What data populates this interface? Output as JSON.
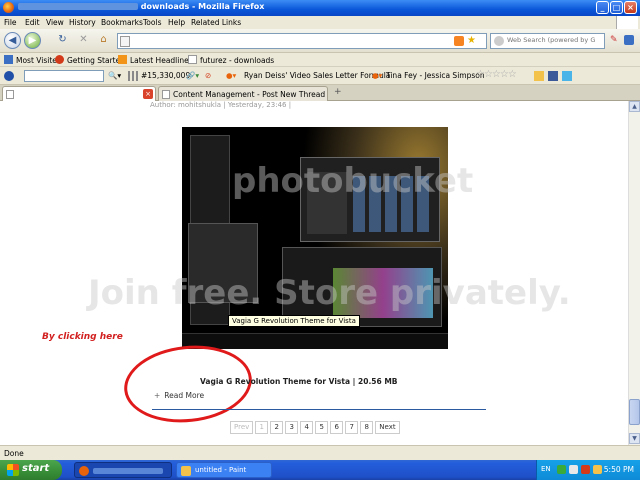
{
  "window": {
    "title_prefix": "",
    "title_suffix": "downloads - Mozilla Firefox"
  },
  "menu": [
    "File",
    "Edit",
    "View",
    "History",
    "Bookmarks",
    "Tools",
    "Help",
    "Related Links"
  ],
  "nav": {
    "url": "",
    "search_placeholder": "Web Search (powered by G"
  },
  "bookmarks": [
    {
      "label": "Most Visited",
      "color": "#3a6fc4"
    },
    {
      "label": "Getting Started",
      "color": "#d23a1a"
    },
    {
      "label": "Latest Headlines",
      "color": "#f29418"
    },
    {
      "label": "futurez - downloads",
      "color": "#3a6fc4"
    }
  ],
  "toolbar2": {
    "count": "#15,330,009",
    "link1": "Ryan Deiss' Video Sales Letter Formula",
    "link2": "Tina Fey - Jessica Simpson"
  },
  "tabs": [
    {
      "label": "",
      "active": true
    },
    {
      "label": "Content Management - Post New Thread",
      "active": false
    }
  ],
  "post": {
    "author_line": "Author: mohitshukla  |  Yesterday, 23:46  |",
    "screenshot_caption": "Vagia G Revolution Theme for Vista",
    "annotation": "By clicking here",
    "title": "Vagia G Revolution Theme for Vista | 20.56 MB",
    "read_more": "Read More",
    "watermark_top": "photobucket",
    "watermark_bottom": "Join free. Store privately."
  },
  "pager": {
    "prev": "Prev",
    "pages": [
      "1",
      "2",
      "3",
      "4",
      "5",
      "6",
      "7",
      "8"
    ],
    "next": "Next"
  },
  "status": "Done",
  "taskbar": {
    "start": "start",
    "items": [
      {
        "label": ""
      },
      {
        "label": "untitled - Paint"
      }
    ],
    "lang": "EN",
    "clock": "5:50 PM"
  }
}
